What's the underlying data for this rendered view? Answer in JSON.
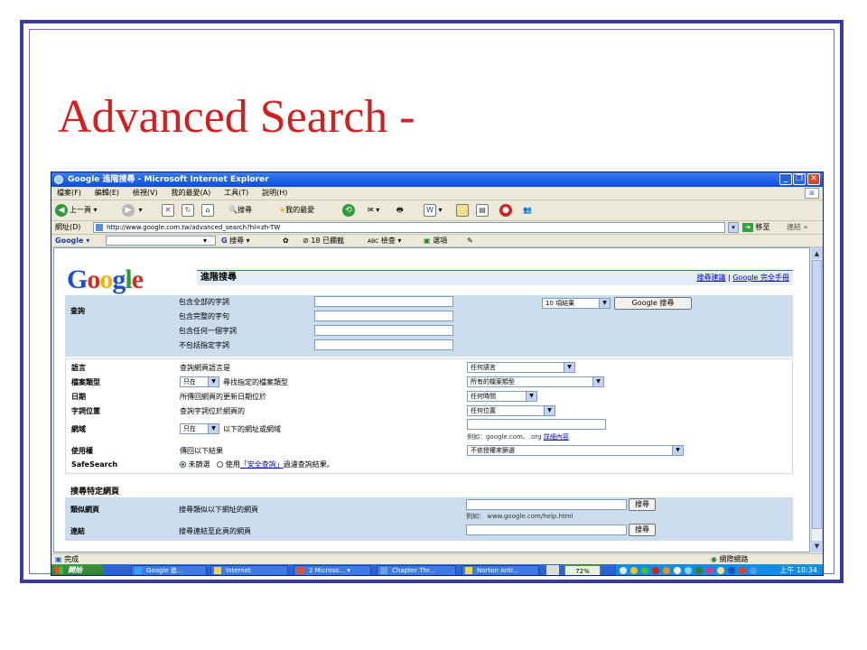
{
  "slide": {
    "title": "Advanced Search -"
  },
  "browser": {
    "window_title": "Google 進階搜尋 - Microsoft Internet Explorer",
    "menu": [
      "檔案(F)",
      "編輯(E)",
      "檢視(V)",
      "我的最愛(A)",
      "工具(T)",
      "說明(H)"
    ],
    "toolbar": {
      "back": "上一頁",
      "search": "搜尋",
      "favorites": "我的最愛"
    },
    "address_label": "網址(D)",
    "url": "http://www.google.com.tw/advanced_search?hl=zh-TW",
    "go": "移至",
    "links": "連結",
    "google_toolbar": {
      "logo": "Google",
      "search": "搜尋",
      "blocked": "18 已攔截",
      "check": "檢查",
      "options": "選項"
    },
    "status": "完成",
    "zone": "網際網路"
  },
  "page": {
    "logo_letters": [
      "G",
      "o",
      "o",
      "g",
      "l",
      "e"
    ],
    "logo_colors": [
      "#1f4fd1",
      "#d62d20",
      "#f4b400",
      "#1f4fd1",
      "#2b9a3e",
      "#d62d20"
    ],
    "header_title": "進階搜尋",
    "header_links": {
      "tips": "搜尋建議",
      "sep": " | ",
      "manual": "Google 完全手冊"
    },
    "query": {
      "label": "查詢",
      "rows": [
        "包含全部的字詞",
        "包含完整的字句",
        "包含任何一個字詞",
        "不包括指定字詞"
      ],
      "results_select": "10 項結果",
      "search_button": "Google 搜尋"
    },
    "options": {
      "language": {
        "label": "語言",
        "desc": "查詢網頁語言是",
        "value": "任何語言"
      },
      "filetype": {
        "label": "檔案類型",
        "only": "只在",
        "desc": "尋找指定的檔案類型",
        "value": "所有的檔案類型"
      },
      "date": {
        "label": "日期",
        "desc": "所傳回網頁的更新日期位於",
        "value": "任何時間"
      },
      "occurrence": {
        "label": "字詞位置",
        "desc": "查詢字詞位於網頁的",
        "value": "任何位置"
      },
      "domain": {
        "label": "網域",
        "only": "只在",
        "desc": "以下的網址或網域",
        "hint": "例如：google.com、.org",
        "hint_link": "詳細內容"
      },
      "rights": {
        "label": "使用權",
        "desc": "傳回以下結果",
        "value": "不依授權來篩選"
      },
      "safesearch": {
        "label": "SafeSearch",
        "off": "未篩選",
        "use": "使用",
        "link": "「安全查詢」",
        "after": "過濾查詢結果。"
      }
    },
    "site_search": {
      "title": "搜尋特定網頁",
      "similar": {
        "label": "類似網頁",
        "desc": "搜尋類似以下網址的網頁",
        "button": "搜尋",
        "hint": "例如： www.google.com/help.html"
      },
      "links": {
        "label": "連結",
        "desc": "搜尋連結至此頁的網頁",
        "button": "搜尋"
      }
    }
  },
  "taskbar": {
    "start": "開始",
    "items": [
      "Google 進...",
      "Internet",
      "2 Microso...",
      "Chapter Thr...",
      "Norton Anti..."
    ],
    "battery": "72%",
    "clock": "上午 10:34"
  }
}
